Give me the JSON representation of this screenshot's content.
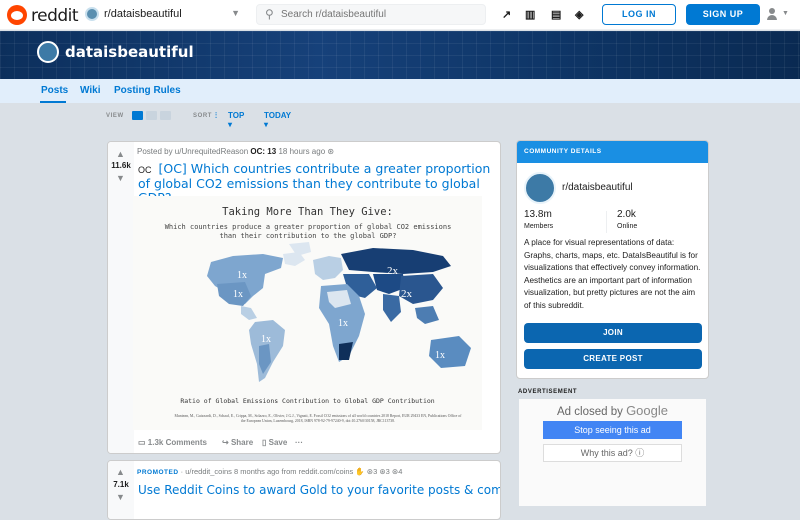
{
  "header": {
    "logo_text": "reddit",
    "subreddit_selector": "r/dataisbeautiful",
    "search_placeholder": "Search r/dataisbeautiful",
    "login_label": "LOG IN",
    "signup_label": "SIGN UP"
  },
  "banner": {
    "name": "dataisbeautiful"
  },
  "subnav": {
    "items": [
      "Posts",
      "Wiki",
      "Posting Rules"
    ]
  },
  "sortbar": {
    "view_label": "VIEW",
    "sort_label": "SORT",
    "sort_value": "TOP",
    "time_value": "TODAY"
  },
  "post": {
    "score": "11.6k",
    "meta_prefix": "Posted by u/UnrequitedReason",
    "meta_oc": "OC: 13",
    "meta_time": "18 hours ago",
    "flair": "OC",
    "title_oc": "[OC]",
    "title": "Which countries contribute a greater proportion of global CO2 emissions than they contribute to global GDP?",
    "infographic": {
      "heading": "Taking More Than They Give:",
      "subheading": "Which countries produce a greater proportion of global CO2 emissions than their contribution to the global GDP?",
      "map_labels": [
        "1x",
        "1x",
        "2x",
        "2x",
        "1x",
        "1x",
        "1x"
      ],
      "caption": "Ratio of Global Emissions Contribution to Global GDP Contribution",
      "citation": "Muntean, M., Guizzardi, D., Schaaf, E., Crippa, M., Solazzo, E., Olivier, J.G.J., Vignati, E. Fossil CO2 emissions of all world countries 2018 Report, EUR 29433 EN, Publications Office of the European Union, Luxembourg, 2018, ISBN 978-92-79-97240-9, doi:10.2760/30158, JRC113738."
    },
    "comments": "1.3k Comments",
    "share": "Share",
    "save": "Save",
    "more": "···"
  },
  "promo": {
    "score": "7.1k",
    "label": "PROMOTED",
    "meta": "· u/reddit_coins 8 months ago from reddit.com/coins",
    "award_counts": [
      "3",
      "3",
      "4"
    ],
    "title": "Use Reddit Coins to award Gold to your favorite posts & comments!"
  },
  "sidebar": {
    "header": "COMMUNITY DETAILS",
    "name": "r/dataisbeautiful",
    "members_value": "13.8m",
    "members_label": "Members",
    "online_value": "2.0k",
    "online_label": "Online",
    "description": "A place for visual representations of data: Graphs, charts, maps, etc. DataIsBeautiful is for visualizations that effectively convey information. Aesthetics are an important part of information visualization, but pretty pictures are not the aim of this subreddit.",
    "join_label": "JOIN",
    "create_label": "CREATE POST"
  },
  "ad": {
    "label": "ADVERTISEMENT",
    "closed_by": "Ad closed by",
    "google": "Google",
    "stop_label": "Stop seeing this ad",
    "why_label": "Why this ad? ⓘ"
  },
  "colors": {
    "brand": "#ff4500",
    "accent": "#0079d3"
  }
}
